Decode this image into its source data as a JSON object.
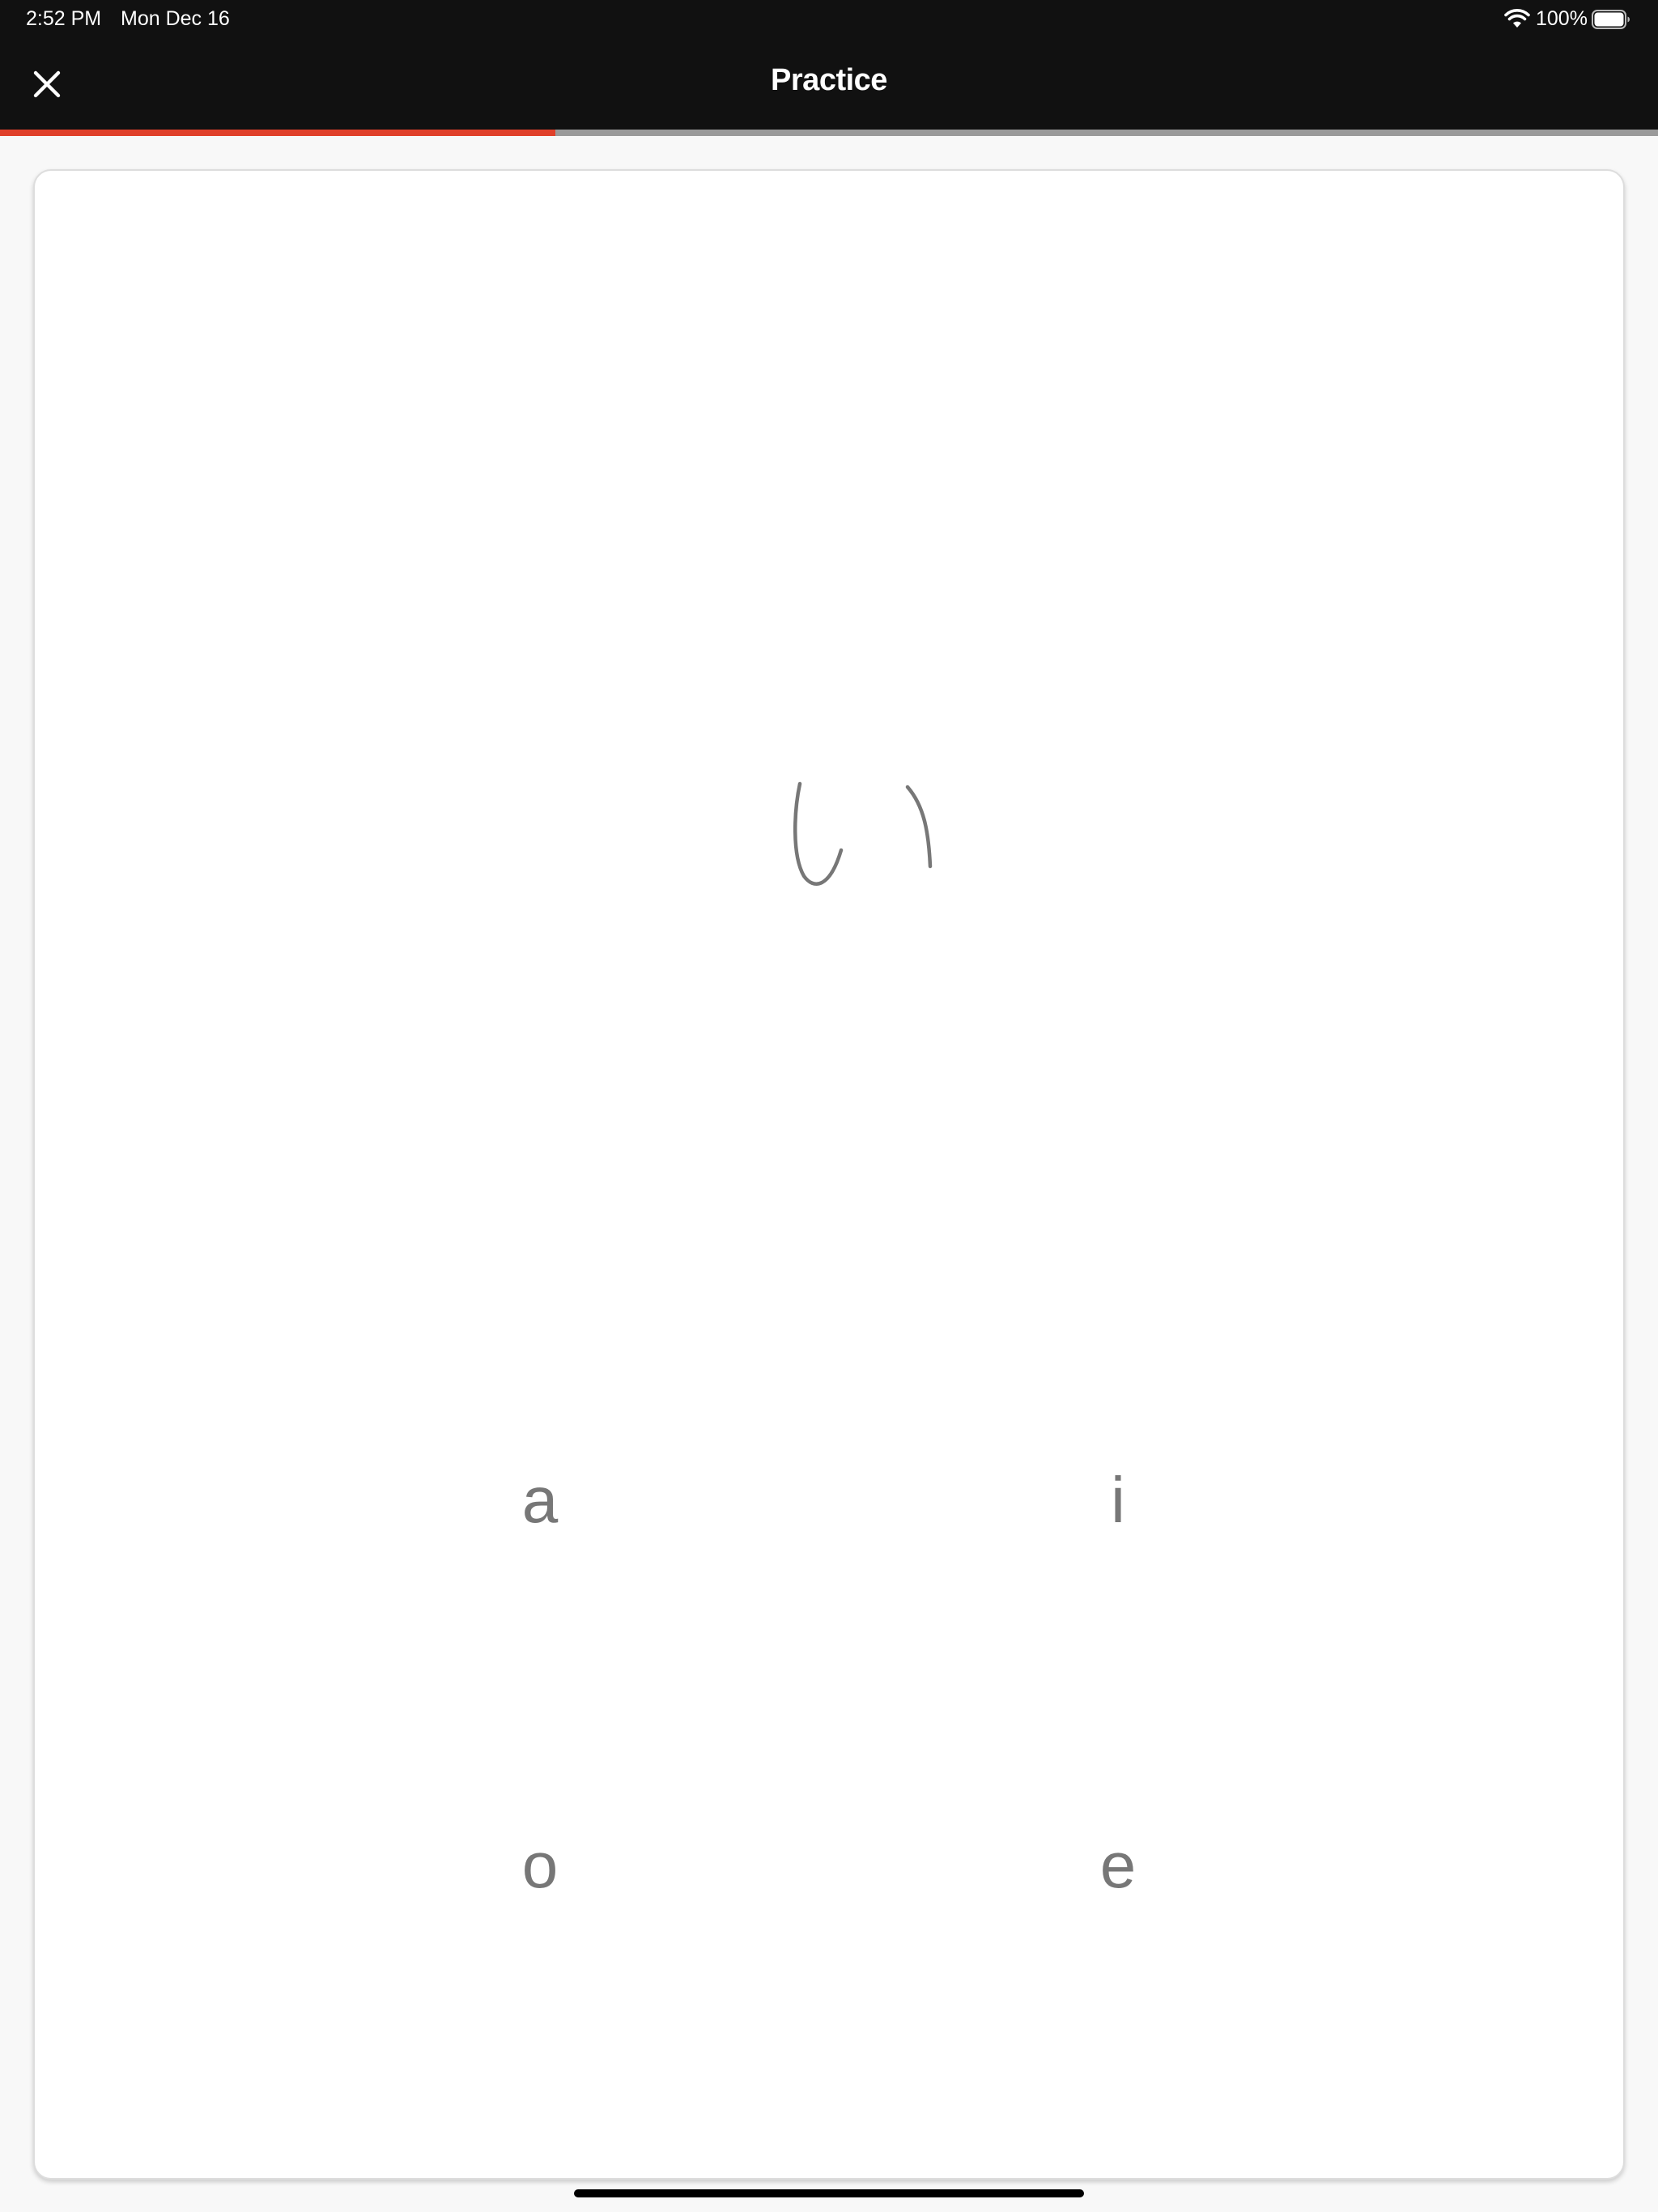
{
  "status_bar": {
    "time": "2:52 PM",
    "date": "Mon Dec 16",
    "battery_percent": "100%",
    "battery_level": 1.0,
    "wifi_icon": "wifi-icon",
    "battery_icon": "battery-icon"
  },
  "nav": {
    "title": "Practice",
    "close_icon": "close-icon"
  },
  "progress": {
    "fraction": 0.335,
    "fill_color": "#e0402a",
    "track_color": "#9a9a9a"
  },
  "question": {
    "prompt_character": "い"
  },
  "options": [
    {
      "label": "a"
    },
    {
      "label": "i"
    },
    {
      "label": "o"
    },
    {
      "label": "e"
    }
  ]
}
